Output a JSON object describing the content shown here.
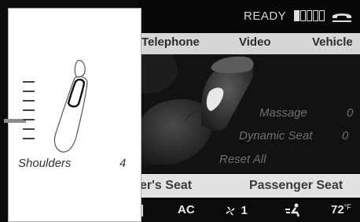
{
  "status": {
    "ready_text": "READY",
    "signal_bars": 5,
    "signal_filled": 1,
    "phone_icon": "phone-handset-icon"
  },
  "tabs": [
    {
      "label": "Telephone"
    },
    {
      "label": "Video"
    },
    {
      "label": "Vehicle"
    }
  ],
  "options": [
    {
      "label": "Massage",
      "value": "0"
    },
    {
      "label": "Dynamic Seat",
      "value": "0"
    },
    {
      "label": "Reset All"
    }
  ],
  "seat_bar": {
    "left": "er's Seat",
    "right": "Passenger Seat"
  },
  "climate": {
    "ac": "AC",
    "fan": "1",
    "temperature": "72",
    "unit": "°F"
  },
  "panel": {
    "label": "Shoulders",
    "value": "4"
  },
  "colors": {
    "accent": "#d6d6d6",
    "background": "#0b0b0b"
  }
}
